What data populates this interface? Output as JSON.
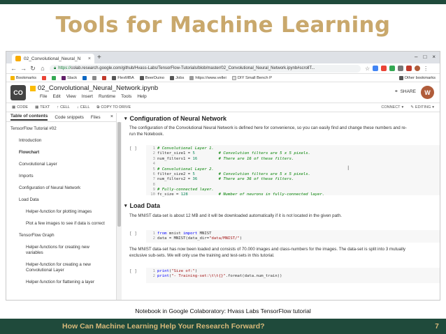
{
  "slide": {
    "title": "Tools for Machine Learning",
    "caption": "Notebook in Google Colaboratory: Hvass Labs TensorFlow tutorial",
    "footer": "How Can Machine Learning Help Your Research Forward?",
    "page_number": "7"
  },
  "browser": {
    "tab_title": "02_Convolutional_Neural_N",
    "url_scheme": "https://",
    "url_rest": "colab.research.google.com/github/Hvass-Labs/TensorFlow-Tutorials/blob/master/02_Convolutional_Neural_Network.ipynb#scrollT...",
    "bookmarks": [
      "Bookmarks",
      "Slack",
      "FlexMBA",
      "BeerDuino",
      "Jobs",
      "https://www.vellei",
      "DIY Small Bench P"
    ],
    "other_bookmarks": "Other bookmarks"
  },
  "colab": {
    "logo": "CO",
    "notebook_title": "02_Convolutional_Neural_Network.ipynb",
    "menu": [
      "File",
      "Edit",
      "View",
      "Insert",
      "Runtime",
      "Tools",
      "Help"
    ],
    "share": "SHARE",
    "avatar": "W",
    "toolbar": [
      "CODE",
      "TEXT",
      "CELL",
      "CELL",
      "COPY TO DRIVE"
    ],
    "connect": "CONNECT",
    "editing": "EDITING"
  },
  "sidebar": {
    "tabs": [
      "Table of contents",
      "Code snippets",
      "Files"
    ],
    "items": [
      "TensorFlow Tutorial #02",
      "Introduction",
      "Flowchart",
      "Convolutional Layer",
      "Imports",
      "Configuration of Neural Network",
      "Load Data",
      "Helper-function for plotting images",
      "Plot a few images to see if data is correct",
      "TensorFlow Graph",
      "Helper-functions for creating new",
      "variables",
      "Helper-function for creating a new",
      "Convolutional Layer",
      "Helper-function for flattening a layer"
    ]
  },
  "notebook": {
    "section1_title": "Configuration of Neural Network",
    "section1_text1": "The configuration of the Convolutional Neural Network is defined here for convenience, so you can easily find and change these numbers and re-",
    "section1_text2": "run the Notebook.",
    "prompt": "[ ]",
    "section2_title": "Load Data",
    "section2_text": "The MNIST data-set is about 12 MB and it will be downloaded automatically if it is not located in the given path.",
    "section2_text2a": "The MNIST data-set has now been loaded and consists of 70.000 images and class-numbers for the images. The data-set is split into 3 mutually",
    "section2_text2b": "exclusive sub-sets. We will only use the training and test-sets in this tutorial."
  }
}
